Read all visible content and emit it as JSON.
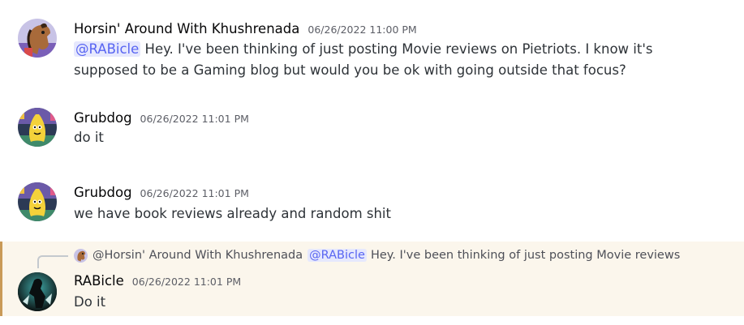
{
  "messages": [
    {
      "author": "Horsin' Around With Khushrenada",
      "timestamp": "06/26/2022 11:00 PM",
      "mention": "@RABicle",
      "text": " Hey. I've been thinking of just posting Movie reviews on Pietriots. I know it's supposed to be a Gaming blog but would you be ok with going outside that focus?",
      "avatar_icon": "horse-mask-avatar"
    },
    {
      "author": "Grubdog",
      "timestamp": "06/26/2022 11:01 PM",
      "text": "do it",
      "avatar_icon": "banana-avatar"
    },
    {
      "author": "Grubdog",
      "timestamp": "06/26/2022 11:01 PM",
      "text": "we have book reviews already and random shit",
      "avatar_icon": "banana-avatar"
    },
    {
      "author": "RABicle",
      "timestamp": "06/26/2022 11:01 PM",
      "text": "Do it",
      "avatar_icon": "dark-figure-avatar",
      "highlighted": true,
      "reply": {
        "author": "@Horsin' Around With Khushrenada",
        "mention": "@RABicle",
        "text": "Hey. I've been thinking of just posting Movie reviews"
      }
    }
  ],
  "colors": {
    "mention_bg": "#e6e8fd",
    "mention_text": "#5865f2",
    "highlight_bg": "#fbf6ec",
    "highlight_bar": "#c99a58"
  }
}
